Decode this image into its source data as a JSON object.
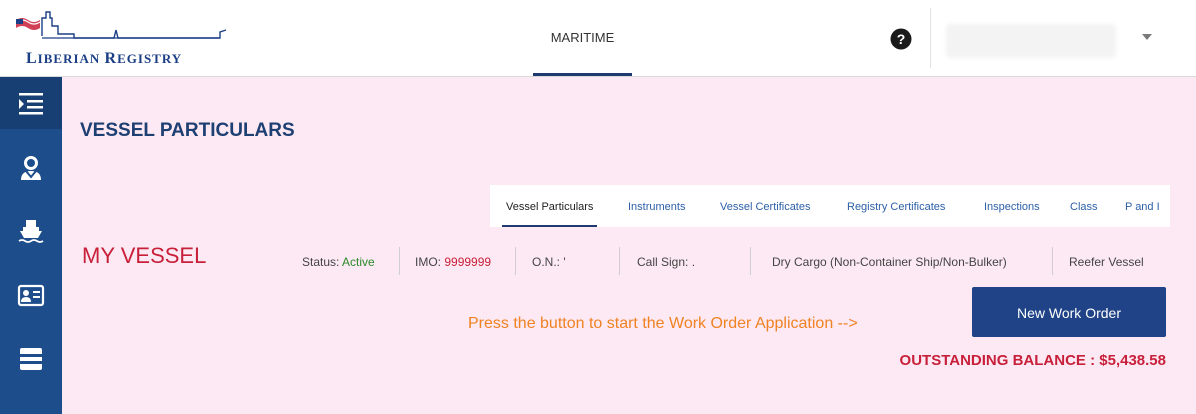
{
  "header": {
    "logo_text_first": "L",
    "logo_text_rest": "IBERIAN ",
    "logo_text_first2": "R",
    "logo_text_rest2": "EGISTRY",
    "nav_tab": "MARITIME",
    "icons": [
      "flag-logo-icon",
      "help-icon",
      "chevron-down-icon"
    ]
  },
  "sidebar": {
    "items": [
      {
        "icon": "menu-toggle-icon"
      },
      {
        "icon": "crew-icon"
      },
      {
        "icon": "ship-icon"
      },
      {
        "icon": "id-card-icon"
      },
      {
        "icon": "payment-card-icon"
      }
    ]
  },
  "page": {
    "title": "VESSEL PARTICULARS",
    "tabs": [
      {
        "label": "Vessel Particulars",
        "active": true
      },
      {
        "label": "Instruments"
      },
      {
        "label": "Vessel Certificates"
      },
      {
        "label": "Registry Certificates"
      },
      {
        "label": "Inspections"
      },
      {
        "label": "Class"
      },
      {
        "label": "P and I"
      }
    ],
    "vessel": {
      "name": "MY VESSEL",
      "status_label": "Status:",
      "status_value": "Active",
      "imo_label": "IMO:",
      "imo_value": "9999999",
      "on_label": "O.N.:",
      "on_value": "'",
      "call_sign_label": "Call Sign:",
      "call_sign_value": ".",
      "type": "Dry Cargo (Non-Container Ship/Non-Bulker)",
      "subtype": "Reefer Vessel"
    },
    "hint": "Press the button to start the Work Order Application  -->",
    "new_work_order": "New Work Order",
    "balance": "OUTSTANDING BALANCE : $5,438.58"
  },
  "colors": {
    "brand_blue": "#1f4386",
    "sidebar_blue": "#1d4d8a",
    "accent_red": "#c8203a",
    "hint_orange": "#f08223",
    "content_bg": "#fde9f3"
  }
}
